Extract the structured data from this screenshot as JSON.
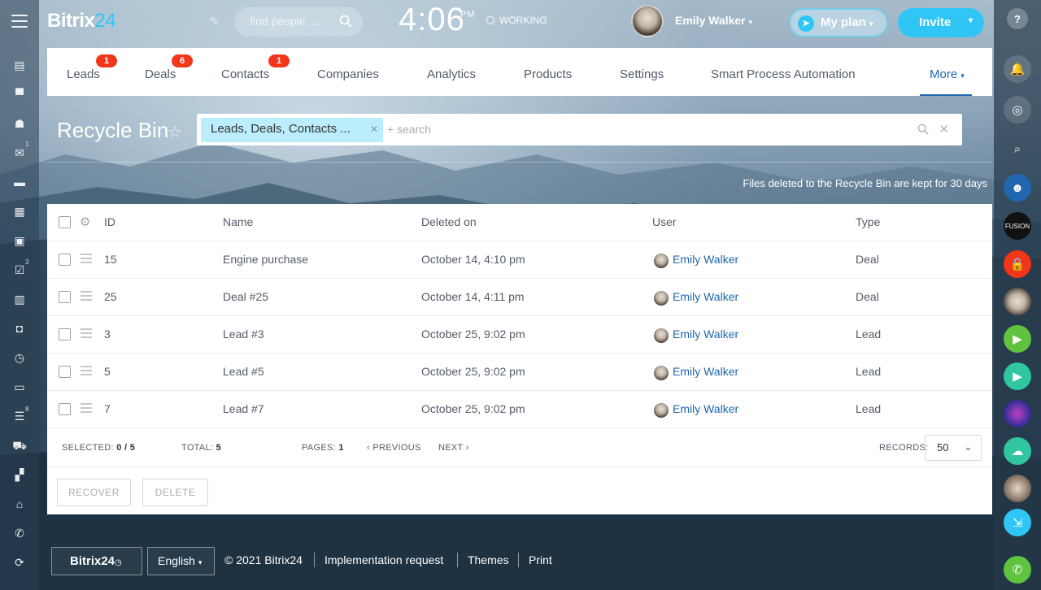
{
  "app": {
    "logo_main": "Bitrix",
    "logo_num": "24"
  },
  "header": {
    "search_placeholder": "find people, ...",
    "clock": "4:06",
    "clock_suffix": "PM",
    "status": "WORKING",
    "user_name": "Emily Walker",
    "myplan_label": "My plan",
    "invite_label": "Invite"
  },
  "left_sidebar": {
    "badges": {
      "mail": "1",
      "tasks": "3",
      "crm": "8"
    }
  },
  "tabs": [
    {
      "label": "Leads",
      "badge": "1"
    },
    {
      "label": "Deals",
      "badge": "6"
    },
    {
      "label": "Contacts",
      "badge": "1"
    },
    {
      "label": "Companies",
      "badge": ""
    },
    {
      "label": "Analytics",
      "badge": ""
    },
    {
      "label": "Products",
      "badge": ""
    },
    {
      "label": "Settings",
      "badge": ""
    },
    {
      "label": "Smart Process Automation",
      "badge": ""
    },
    {
      "label": "More",
      "badge": ""
    }
  ],
  "page": {
    "title": "Recycle Bin",
    "filter_tag": "Leads, Deals, Contacts ...",
    "filter_placeholder": "+ search",
    "note": "Files deleted to the Recycle Bin are kept for 30 days"
  },
  "grid": {
    "columns": [
      "ID",
      "Name",
      "Deleted on",
      "User",
      "Type"
    ],
    "rows": [
      {
        "id": "15",
        "name": "Engine purchase",
        "deleted": "October 14, 4:10 pm",
        "user": "Emily Walker",
        "type": "Deal"
      },
      {
        "id": "25",
        "name": "Deal #25",
        "deleted": "October 14, 4:11 pm",
        "user": "Emily Walker",
        "type": "Deal"
      },
      {
        "id": "3",
        "name": "Lead #3",
        "deleted": "October 25, 9:02 pm",
        "user": "Emily Walker",
        "type": "Lead"
      },
      {
        "id": "5",
        "name": "Lead #5",
        "deleted": "October 25, 9:02 pm",
        "user": "Emily Walker",
        "type": "Lead"
      },
      {
        "id": "7",
        "name": "Lead #7",
        "deleted": "October 25, 9:02 pm",
        "user": "Emily Walker",
        "type": "Lead"
      }
    ],
    "footer": {
      "selected_label": "SELECTED:",
      "selected_value": "0 / 5",
      "total_label": "TOTAL:",
      "total_value": "5",
      "pages_label": "PAGES:",
      "pages_value": "1",
      "previous": "PREVIOUS",
      "next": "NEXT",
      "records_label": "RECORDS:",
      "records_value": "50"
    },
    "actions": {
      "recover": "RECOVER",
      "delete": "DELETE"
    }
  },
  "footer": {
    "logo": "Bitrix24",
    "language": "English",
    "copyright": "© 2021 Bitrix24",
    "links": [
      "Implementation request",
      "Themes",
      "Print"
    ]
  },
  "colors": {
    "accent": "#2fc6f6",
    "link": "#2067b0",
    "badge": "#f1361a"
  }
}
